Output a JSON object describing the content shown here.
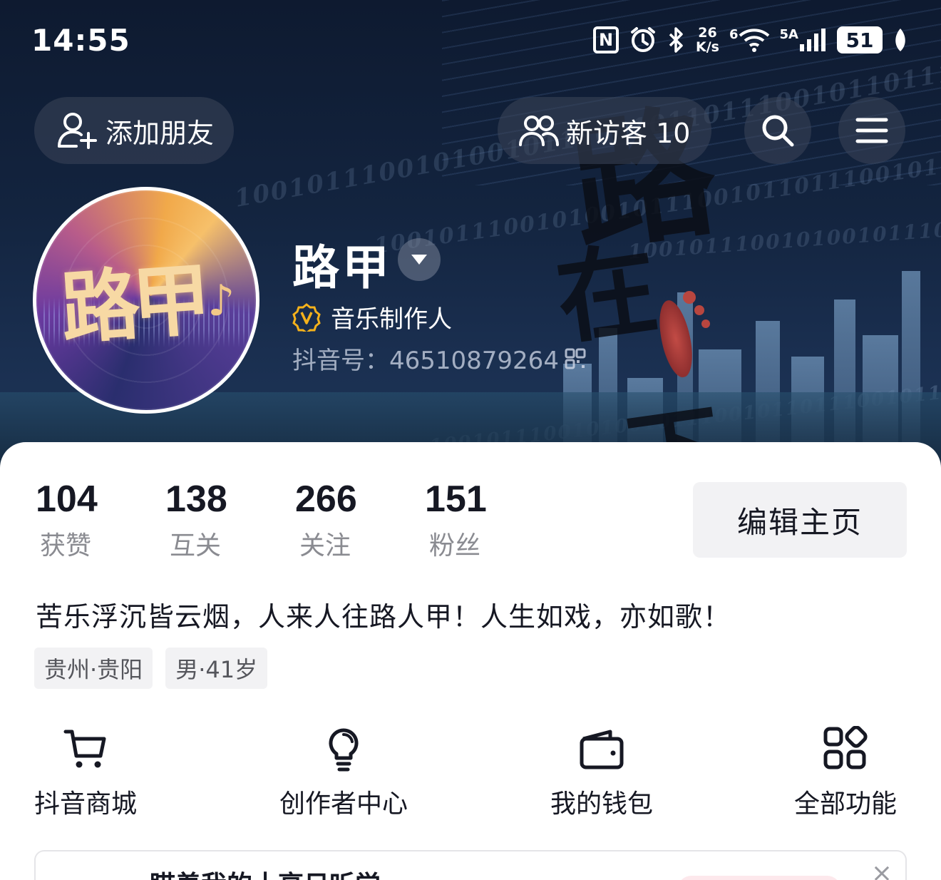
{
  "status_bar": {
    "time": "14:55",
    "nfc": "N",
    "net_speed_top": "26",
    "net_speed_bottom": "K/s",
    "wifi_label": "6",
    "signal_label": "5A",
    "battery": "51"
  },
  "top_nav": {
    "add_friend": "添加朋友",
    "new_visitors": "新访客 10"
  },
  "banner": {
    "calligraphy_1": "路",
    "calligraphy_2": "在",
    "calligraphy_3": "下",
    "binary_text": "1001011100101001011100101101110010110111001011011"
  },
  "profile": {
    "avatar_text": "路甲",
    "avatar_note": "♪",
    "name": "路甲",
    "verification": "音乐制作人",
    "douyin_id": "抖音号：46510879264"
  },
  "stats": [
    {
      "value": "104",
      "label": "获赞"
    },
    {
      "value": "138",
      "label": "互关"
    },
    {
      "value": "266",
      "label": "关注"
    },
    {
      "value": "151",
      "label": "粉丝"
    }
  ],
  "edit_profile": "编辑主页",
  "bio": "苦乐浮沉皆云烟，人来人往路人甲！人生如戏，亦如歌！",
  "tags": [
    "贵州·贵阳",
    "男·41岁"
  ],
  "features": [
    {
      "label": "抖音商城",
      "icon": "cart-icon"
    },
    {
      "label": "创作者中心",
      "icon": "lightbulb-icon"
    },
    {
      "label": "我的钱包",
      "icon": "wallet-icon"
    },
    {
      "label": "全部功能",
      "icon": "grid-icon"
    }
  ],
  "bottom_card": {
    "text": "瞄着我的十亮日听觉",
    "close": "×"
  },
  "colors": {
    "banner_bg": "#13243f",
    "text_primary": "#161823",
    "text_secondary": "#8a8b91",
    "verify_badge": "#f5b21b",
    "button_bg": "#f2f2f4"
  }
}
